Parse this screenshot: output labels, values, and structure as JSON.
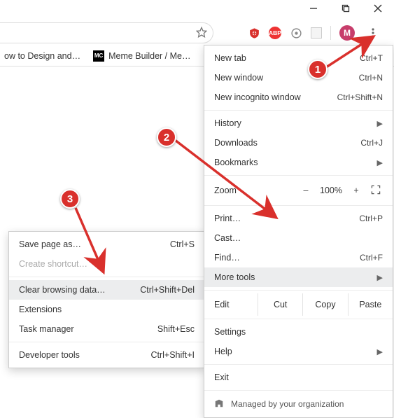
{
  "window_controls": {
    "min": "minimize",
    "max": "maximize",
    "close": "close"
  },
  "bookmarks": [
    {
      "label": "ow to Design and…"
    },
    {
      "label": "Meme Builder / Me…",
      "favicon": "MC"
    }
  ],
  "extensions": {
    "ublock": "⎔",
    "abp": "ABP",
    "avatar_letter": "M"
  },
  "main_menu": {
    "new_tab": {
      "label": "New tab",
      "shortcut": "Ctrl+T"
    },
    "new_window": {
      "label": "New window",
      "shortcut": "Ctrl+N"
    },
    "incognito": {
      "label": "New incognito window",
      "shortcut": "Ctrl+Shift+N"
    },
    "history": {
      "label": "History"
    },
    "downloads": {
      "label": "Downloads",
      "shortcut": "Ctrl+J"
    },
    "bookmarks": {
      "label": "Bookmarks"
    },
    "zoom_label": "Zoom",
    "zoom_value": "100%",
    "zoom_minus": "–",
    "zoom_plus": "+",
    "print": {
      "label": "Print…",
      "shortcut": "Ctrl+P"
    },
    "cast": {
      "label": "Cast…"
    },
    "find": {
      "label": "Find…",
      "shortcut": "Ctrl+F"
    },
    "more_tools": {
      "label": "More tools"
    },
    "edit_label": "Edit",
    "edit_cut": "Cut",
    "edit_copy": "Copy",
    "edit_paste": "Paste",
    "settings": {
      "label": "Settings"
    },
    "help": {
      "label": "Help"
    },
    "exit": {
      "label": "Exit"
    },
    "managed": "Managed by your organization"
  },
  "sub_menu": {
    "save_page": {
      "label": "Save page as…",
      "shortcut": "Ctrl+S"
    },
    "create_shortcut": {
      "label": "Create shortcut…"
    },
    "clear_data": {
      "label": "Clear browsing data…",
      "shortcut": "Ctrl+Shift+Del"
    },
    "extensions": {
      "label": "Extensions"
    },
    "task_mgr": {
      "label": "Task manager",
      "shortcut": "Shift+Esc"
    },
    "dev_tools": {
      "label": "Developer tools",
      "shortcut": "Ctrl+Shift+I"
    }
  },
  "annotations": {
    "b1": "1",
    "b2": "2",
    "b3": "3"
  }
}
